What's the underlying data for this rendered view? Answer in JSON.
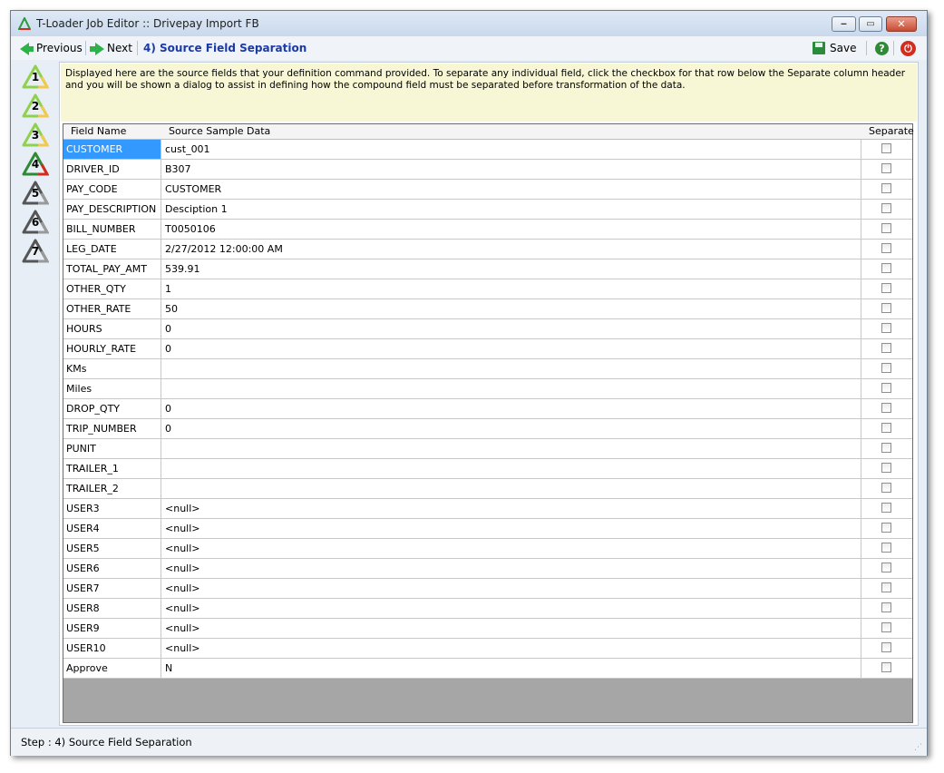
{
  "window": {
    "title": "T-Loader Job Editor :: Drivepay Import FB",
    "min_glyph": "‒",
    "max_glyph": "▭",
    "close_glyph": "✕"
  },
  "toolbar": {
    "previous_label": "Previous",
    "next_label": "Next",
    "step_title": "4) Source Field Separation",
    "save_label": "Save",
    "help_glyph": "?",
    "power_glyph": "⏻"
  },
  "steps": [
    "1",
    "2",
    "3",
    "4",
    "5",
    "6",
    "7"
  ],
  "info_text": "Displayed here are the source fields that your definition command provided. To separate any individual field, click the checkbox for that row below the Separate column header and you will be shown a dialog to assist in defining how the compound field must be separated before transformation of the data.",
  "grid": {
    "headers": {
      "field_name": "Field Name",
      "sample_data": "Source Sample Data",
      "separate": "Separate"
    },
    "rows": [
      {
        "name": "CUSTOMER",
        "data": "cust_001"
      },
      {
        "name": "DRIVER_ID",
        "data": "B307"
      },
      {
        "name": "PAY_CODE",
        "data": "CUSTOMER"
      },
      {
        "name": "PAY_DESCRIPTION",
        "data": "Desciption 1"
      },
      {
        "name": "BILL_NUMBER",
        "data": "T0050106"
      },
      {
        "name": "LEG_DATE",
        "data": "2/27/2012 12:00:00 AM"
      },
      {
        "name": "TOTAL_PAY_AMT",
        "data": "539.91"
      },
      {
        "name": "OTHER_QTY",
        "data": "1"
      },
      {
        "name": "OTHER_RATE",
        "data": "50"
      },
      {
        "name": "HOURS",
        "data": "0"
      },
      {
        "name": "HOURLY_RATE",
        "data": "0"
      },
      {
        "name": "KMs",
        "data": ""
      },
      {
        "name": "Miles",
        "data": ""
      },
      {
        "name": "DROP_QTY",
        "data": "0"
      },
      {
        "name": "TRIP_NUMBER",
        "data": "0"
      },
      {
        "name": "PUNIT",
        "data": ""
      },
      {
        "name": "TRAILER_1",
        "data": ""
      },
      {
        "name": "TRAILER_2",
        "data": ""
      },
      {
        "name": "USER3",
        "data": "<null>"
      },
      {
        "name": "USER4",
        "data": "<null>"
      },
      {
        "name": "USER5",
        "data": "<null>"
      },
      {
        "name": "USER6",
        "data": "<null>"
      },
      {
        "name": "USER7",
        "data": "<null>"
      },
      {
        "name": "USER8",
        "data": "<null>"
      },
      {
        "name": "USER9",
        "data": "<null>"
      },
      {
        "name": "USER10",
        "data": "<null>"
      },
      {
        "name": "Approve",
        "data": "N"
      }
    ]
  },
  "status": "Step : 4) Source Field Separation",
  "colors": {
    "selection": "#3399ff",
    "info_background": "#f7f7d6",
    "step_title": "#1a3aa8",
    "arrow": "#2db24a"
  }
}
